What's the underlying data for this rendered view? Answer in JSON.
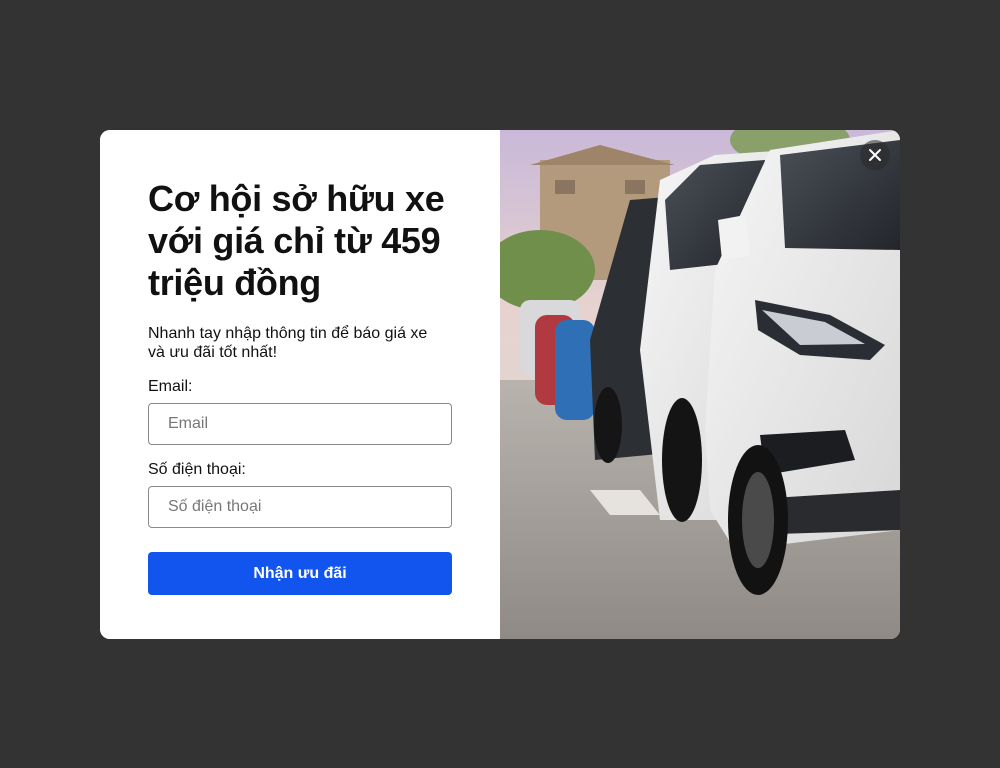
{
  "popup": {
    "headline": "Cơ hội sở hữu xe với giá chỉ từ 459 triệu đồng",
    "subtext": "Nhanh tay nhập thông tin để báo giá xe và ưu đãi tốt nhất!",
    "email_label": "Email:",
    "email_placeholder": "Email",
    "phone_label": "Số điện thoại:",
    "phone_placeholder": "Số điện thoại",
    "submit_label": "Nhận ưu đãi",
    "close_icon": "close-icon",
    "image": "cars-parked-photo"
  },
  "colors": {
    "overlay": "#333333",
    "button": "#1155ee",
    "text": "#111111"
  }
}
